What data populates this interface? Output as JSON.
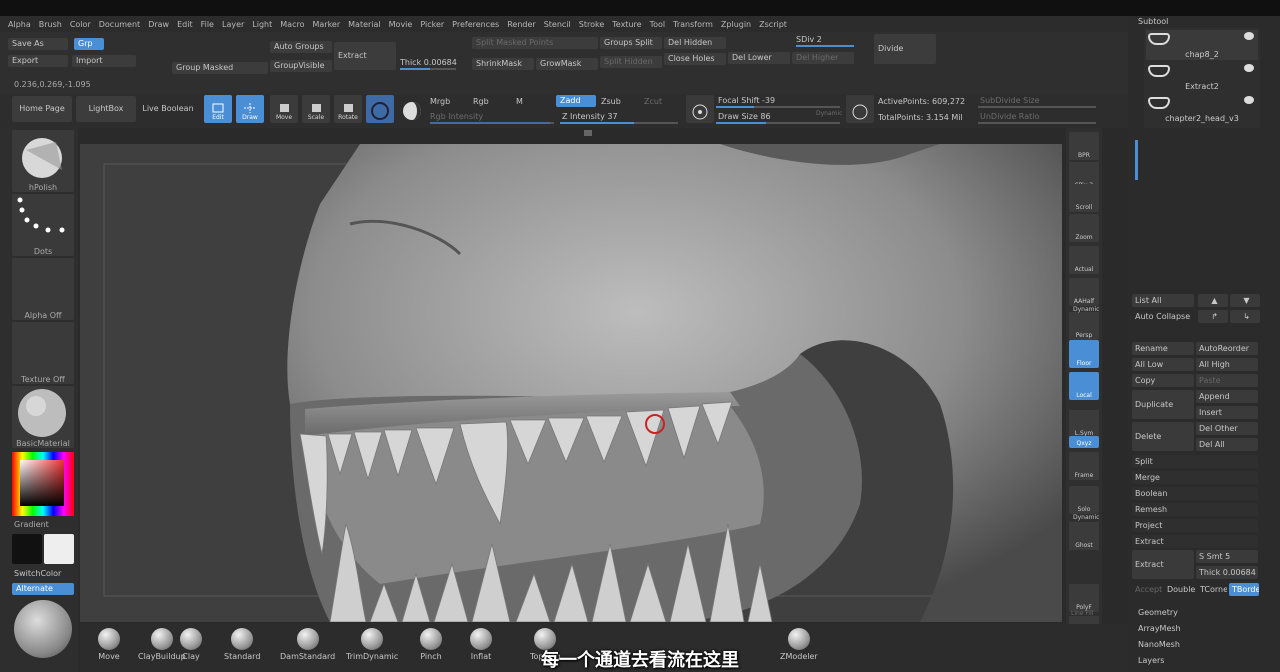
{
  "menu": [
    "Alpha",
    "Brush",
    "Color",
    "Document",
    "Draw",
    "Edit",
    "File",
    "Layer",
    "Light",
    "Macro",
    "Marker",
    "Material",
    "Movie",
    "Picker",
    "Preferences",
    "Render",
    "Stencil",
    "Stroke",
    "Texture",
    "Tool",
    "Transform",
    "Zplugin",
    "Zscript"
  ],
  "toolbar": {
    "save_as": "Save As",
    "grp": "Grp",
    "export": "Export",
    "import": "Import",
    "coords": "0.236,0.269,-1.095",
    "group_masked": "Group Masked",
    "auto_groups": "Auto Groups",
    "group_visible": "GroupVisible",
    "extract": "Extract",
    "thick_label": "Thick",
    "thick_value": "0.00684",
    "split_masked_points": "Split Masked Points",
    "groups_split": "Groups Split",
    "del_hidden": "Del Hidden",
    "sdiv_label": "SDiv",
    "sdiv_value": "2",
    "divide": "Divide",
    "shrink_mask": "ShrinkMask",
    "grow_mask": "GrowMask",
    "split_hidden": "Split Hidden",
    "close_holes": "Close Holes",
    "del_lower": "Del Lower",
    "del_higher": "Del Higher"
  },
  "shelf": {
    "home_page": "Home Page",
    "lightbox": "LightBox",
    "live_boolean": "Live Boolean",
    "edit": "Edit",
    "draw": "Draw",
    "move": "Move",
    "scale": "Scale",
    "rotate": "Rotate",
    "mrgb": "Mrgb",
    "rgb": "Rgb",
    "m": "M",
    "zadd": "Zadd",
    "zsub": "Zsub",
    "zcut": "Zcut",
    "rgb_intensity": "Rgb Intensity",
    "z_intensity_label": "Z Intensity",
    "z_intensity_value": "37",
    "focal_shift_label": "Focal Shift",
    "focal_shift_value": "-39",
    "draw_size_label": "Draw Size",
    "draw_size_value": "86",
    "dynamic": "Dynamic",
    "active_points_label": "ActivePoints:",
    "active_points_value": "609,272",
    "total_points_label": "TotalPoints:",
    "total_points_value": "3.154 Mil",
    "subdivide_size": "SubDivide Size",
    "undivide_ratio": "UnDivide Ratio"
  },
  "left_tray": {
    "brush_name": "hPolish",
    "stroke_name": "Dots",
    "alpha_name": "Alpha Off",
    "texture_name": "Texture Off",
    "material_name": "BasicMaterial",
    "gradient": "Gradient",
    "switch_color": "SwitchColor",
    "alternate": "Alternate"
  },
  "right_bar": [
    "BPR",
    "SPix 3",
    "Scroll",
    "Zoom",
    "Actual",
    "AAHalf",
    "Persp",
    "Floor",
    "Local",
    "L.Sym",
    "Qxyz",
    "Frame",
    "Solo",
    "Ghost",
    "PolyF",
    "Transp"
  ],
  "right_bar_extra": {
    "dynamic1": "Dynamic",
    "dynamic2": "Dynamic",
    "linefill": "Line Fill"
  },
  "subtool": {
    "title": "Subtool",
    "items": [
      {
        "name": "chap8_2"
      },
      {
        "name": "Extract2"
      },
      {
        "name": "chapter2_head_v3"
      }
    ],
    "list_all": "List All",
    "auto_collapse": "Auto Collapse",
    "rename": "Rename",
    "auto_reorder": "AutoReorder",
    "all_low": "All Low",
    "all_high": "All High",
    "copy": "Copy",
    "paste": "Paste",
    "duplicate": "Duplicate",
    "append": "Append",
    "insert": "Insert",
    "delete": "Delete",
    "del_other": "Del Other",
    "del_all": "Del All",
    "split": "Split",
    "merge": "Merge",
    "boolean": "Boolean",
    "remesh": "Remesh",
    "project": "Project",
    "extract_header": "Extract",
    "extract_btn": "Extract",
    "s_smt": "S Smt 5",
    "thick": "Thick 0.00684",
    "accept": "Accept",
    "double": "Double",
    "tcorne": "TCorne",
    "tborde": "TBorde",
    "geometry": "Geometry",
    "array_mesh": "ArrayMesh",
    "nano_mesh": "NanoMesh",
    "layers": "Layers"
  },
  "brushes": [
    {
      "name": "Move"
    },
    {
      "name": "ClayBuildup"
    },
    {
      "name": "Clay"
    },
    {
      "name": "Standard"
    },
    {
      "name": "DamStandard"
    },
    {
      "name": "TrimDynamic"
    },
    {
      "name": "Pinch"
    },
    {
      "name": "Inflat"
    },
    {
      "name": "Topolog"
    },
    {
      "name": "ZModeler"
    }
  ],
  "subtitle": "每一个通道去看流在这里",
  "colors": {
    "accent": "#4a8fd6",
    "bg": "#2a2a2a",
    "panel": "#353535"
  }
}
